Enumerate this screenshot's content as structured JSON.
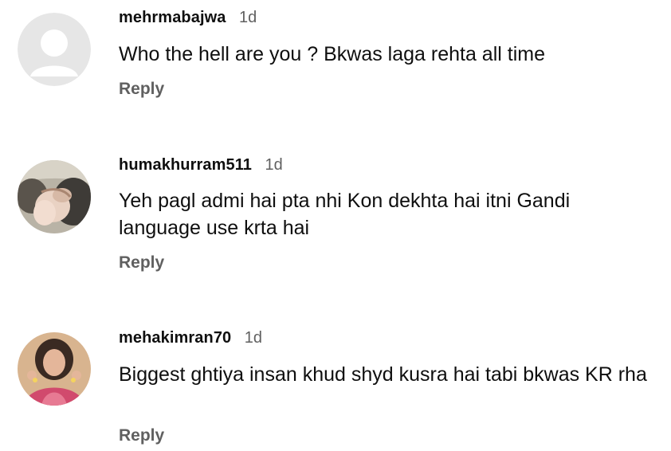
{
  "comments": [
    {
      "username": "mehrmabajwa",
      "time": "1d",
      "text": "Who the hell are you ? Bkwas laga rehta all time",
      "reply_label": "Reply",
      "avatar": "default-avatar-icon"
    },
    {
      "username": "humakhurram511",
      "time": "1d",
      "text": "Yeh pagl admi hai pta nhi Kon dekhta hai itni Gandi language use krta hai",
      "reply_label": "Reply",
      "avatar": "photo-avatar-hands"
    },
    {
      "username": "mehakimran70",
      "time": "1d",
      "text": "Biggest ghtiya insan khud shyd kusra hai tabi bkwas KR rha",
      "reply_label": "Reply",
      "avatar": "photo-avatar-woman"
    }
  ],
  "colors": {
    "text": "#0f0f0f",
    "secondary": "#606060",
    "default_avatar_bg": "#e5e5e5"
  }
}
